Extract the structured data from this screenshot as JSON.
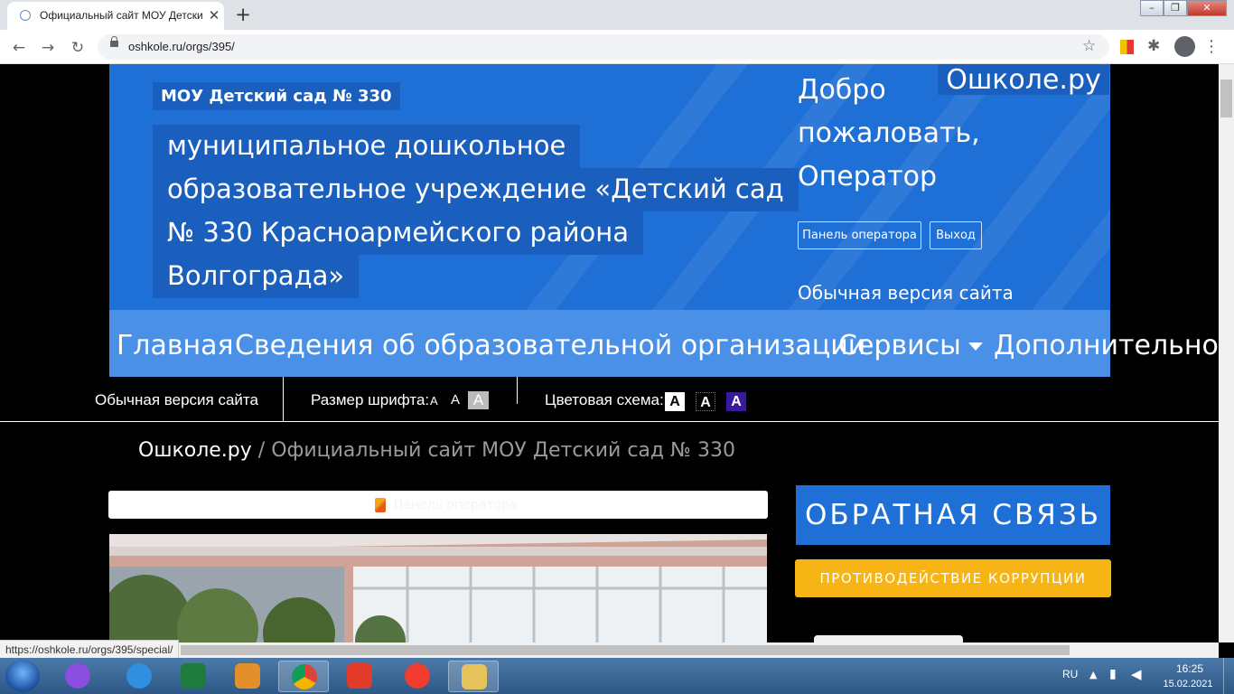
{
  "browser": {
    "tab_title": "Официальный сайт МОУ Детский сад № 330",
    "url": "oshkole.ru/orgs/395/",
    "status_url": "https://oshkole.ru/orgs/395/special/"
  },
  "header": {
    "org_short": "МОУ Детский сад № 330",
    "org_full_lines": [
      "муниципальное дошкольное",
      "образовательное учреждение «Детский сад",
      "№ 330 Красноармейского района",
      "Волгограда»"
    ],
    "greeting_lines": [
      "Добро",
      "пожаловать,",
      "Оператор"
    ],
    "site_brand": "Ошколе.ру",
    "operator_panel_button": "Панель оператора",
    "logout_button": "Выход",
    "normal_version_link": "Обычная версия сайта"
  },
  "menu": {
    "items": [
      "Главная",
      "Сведения об образовательной организации",
      "Сервисы",
      "Дополнительно"
    ]
  },
  "accessibility": {
    "normal_version": "Обычная версия сайта",
    "font_size_label": "Размер шрифта:",
    "font_sizes": [
      "А",
      "А",
      "А"
    ],
    "color_scheme_label": "Цветовая схема:",
    "color_schemes": [
      "А",
      "А",
      "А"
    ]
  },
  "breadcrumb": {
    "root": "Ошколе.ру",
    "separator": " / ",
    "current": "Официальный сайт МОУ Детский сад № 330"
  },
  "content": {
    "operator_panel_label": "Панель оператора"
  },
  "sidebar": {
    "feedback_button": "ОБРАТНАЯ СВЯЗЬ",
    "anticorruption_button": "ПРОТИВОДЕЙСТВИЕ КОРРУПЦИИ"
  },
  "taskbar": {
    "lang": "RU",
    "time": "16:25",
    "date": "15.02.2021"
  },
  "colors": {
    "header_blue": "#1e6fd6",
    "menu_blue": "#4a90e6",
    "anticorruption_yellow": "#f7b515"
  }
}
